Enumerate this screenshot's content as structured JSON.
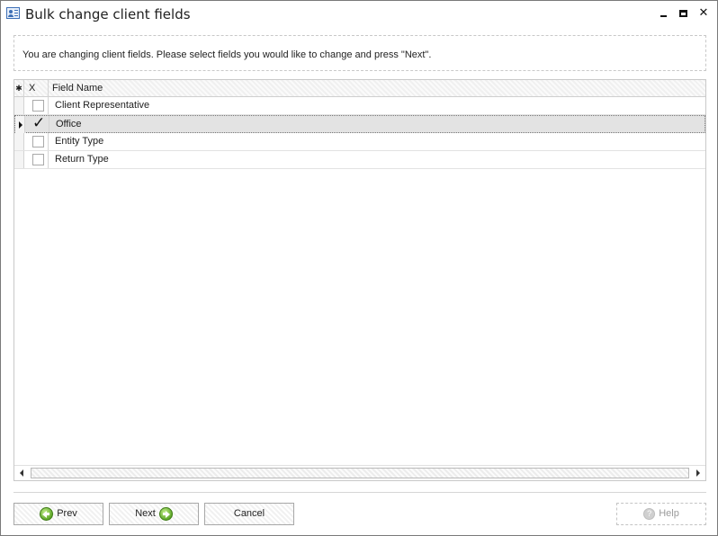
{
  "window": {
    "title": "Bulk change client fields",
    "icon": "contact-card-icon",
    "minimize_label": "",
    "maximize_label": "",
    "close_label": "✕"
  },
  "info": {
    "message": "You are changing client fields. Please select fields you would like to change and press \"Next\"."
  },
  "grid": {
    "header": {
      "indicator": "✱",
      "check_col": "X",
      "name_col": "Field Name"
    },
    "rows": [
      {
        "name": "Client Representative",
        "checked": false,
        "current": false
      },
      {
        "name": "Office",
        "checked": true,
        "current": true
      },
      {
        "name": "Entity Type",
        "checked": false,
        "current": false
      },
      {
        "name": "Return Type",
        "checked": false,
        "current": false
      }
    ]
  },
  "buttons": {
    "prev": "Prev",
    "next": "Next",
    "cancel": "Cancel",
    "help": "Help",
    "help_enabled": false
  }
}
